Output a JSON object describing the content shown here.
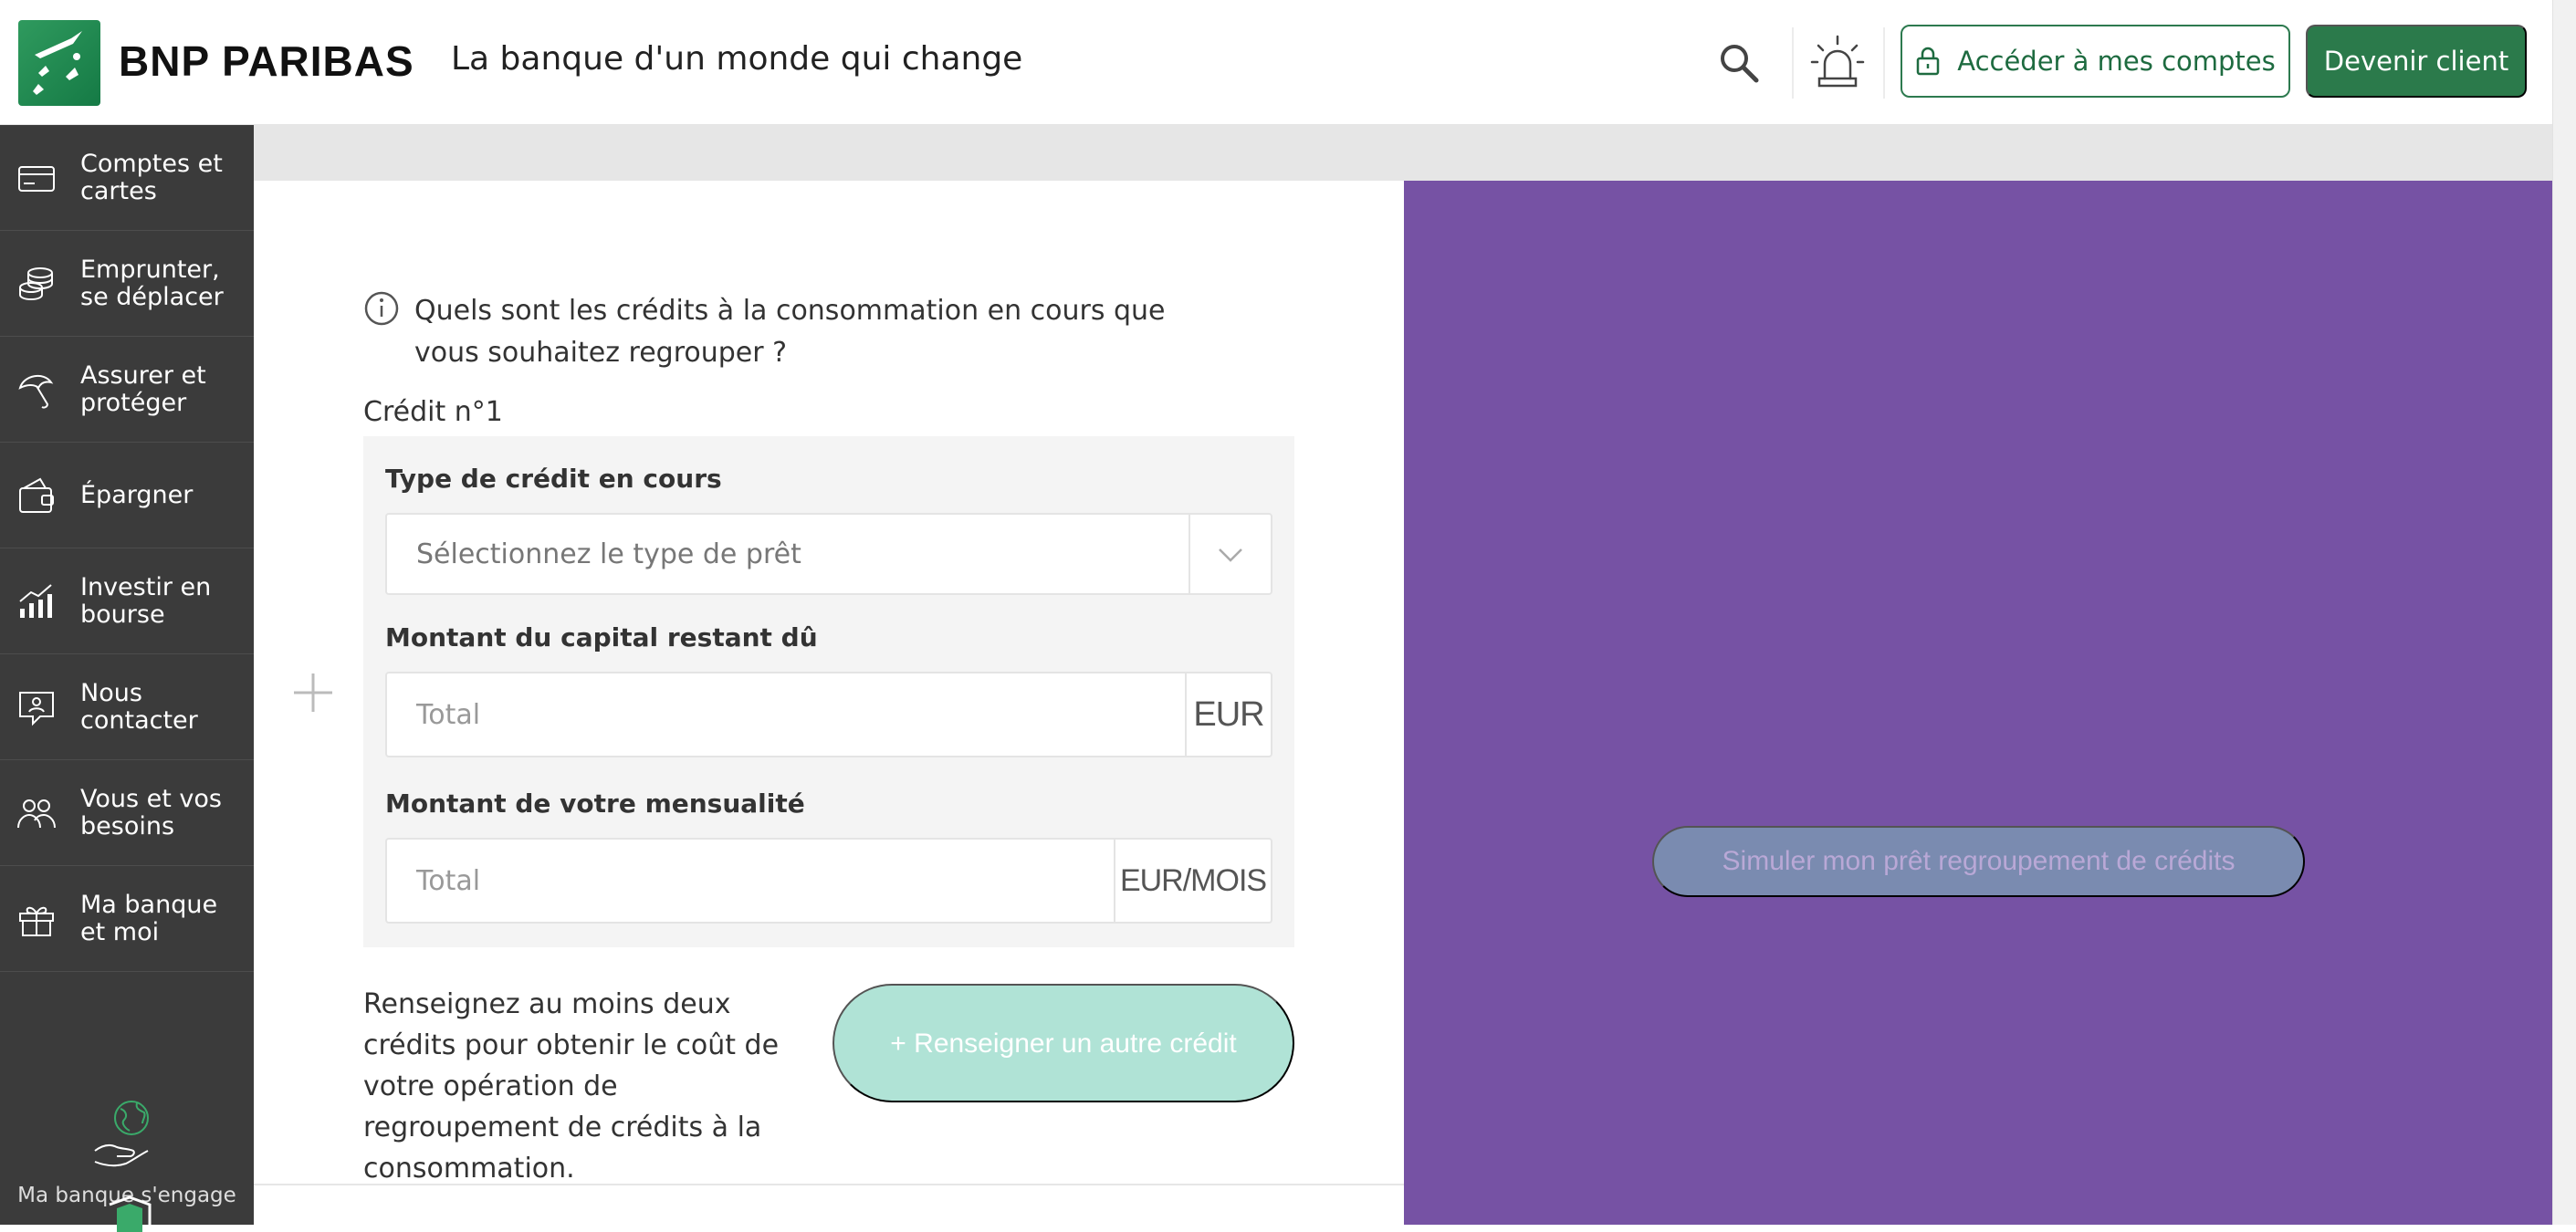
{
  "header": {
    "brand": "BNP PARIBAS",
    "tagline": "La banque d'un monde qui change",
    "access_label": "Accéder à mes comptes",
    "client_label": "Devenir client",
    "icons": [
      "search-icon",
      "alarm-icon",
      "lock-icon"
    ]
  },
  "sidebar": {
    "items": [
      {
        "label": "Comptes et cartes",
        "icon": "card-icon"
      },
      {
        "label": "Emprunter, se déplacer",
        "icon": "coins-icon"
      },
      {
        "label": "Assurer et protéger",
        "icon": "umbrella-icon"
      },
      {
        "label": "Épargner",
        "icon": "wallet-icon"
      },
      {
        "label": "Investir en bourse",
        "icon": "chart-icon"
      },
      {
        "label": "Nous contacter",
        "icon": "contact-icon"
      },
      {
        "label": "Vous et vos besoins",
        "icon": "people-icon"
      },
      {
        "label": "Ma banque et moi",
        "icon": "gift-icon"
      }
    ],
    "engage_label": "Ma banque s'engage"
  },
  "form": {
    "question": "Quels sont les crédits à la consommation en cours que vous souhaitez regrouper ?",
    "credit_title": "Crédit n°1",
    "type_label": "Type de crédit en cours",
    "type_placeholder": "Sélectionnez le type de prêt",
    "capital_label": "Montant du capital restant dû",
    "capital_placeholder": "Total",
    "capital_unit": "EUR",
    "monthly_label": "Montant de votre mensualité",
    "monthly_placeholder": "Total",
    "monthly_unit": "EUR/MOIS",
    "hint": "Renseignez au moins deux crédits pour obtenir le coût de votre opération de regroupement de crédits à la consommation.",
    "add_label": "+ Renseigner un autre crédit"
  },
  "simulate": {
    "label": "Simuler mon prêt regroupement de crédits"
  },
  "colors": {
    "brand_green": "#2b7a4b",
    "sidebar": "#3b3b3b",
    "purple_panel": "#7652a4",
    "add_button": "#b0e3d6"
  }
}
